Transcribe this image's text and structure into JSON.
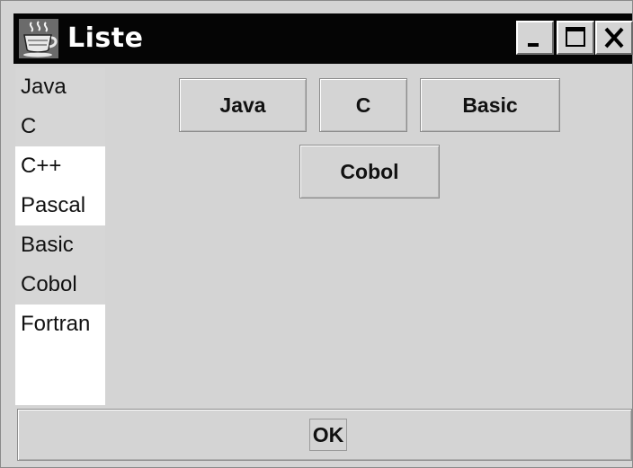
{
  "window": {
    "title": "Liste",
    "controls": {
      "minimize_icon": "minimize-icon",
      "maximize_icon": "maximize-icon",
      "close_icon": "close-icon"
    },
    "app_icon": "coffee-cup-icon"
  },
  "list": {
    "items": [
      {
        "label": "Java",
        "selected": false
      },
      {
        "label": "C",
        "selected": false
      },
      {
        "label": "C++",
        "selected": true
      },
      {
        "label": "Pascal",
        "selected": true
      },
      {
        "label": "Basic",
        "selected": false
      },
      {
        "label": "Cobol",
        "selected": false
      },
      {
        "label": "Fortran",
        "selected": true
      }
    ]
  },
  "buttons": {
    "java": "Java",
    "c": "C",
    "basic": "Basic",
    "cobol": "Cobol"
  },
  "ok": {
    "label": "OK"
  },
  "colors": {
    "titlebar": "#050505",
    "window_bg": "#d4d4d4",
    "list_selected_bg": "#ffffff"
  }
}
